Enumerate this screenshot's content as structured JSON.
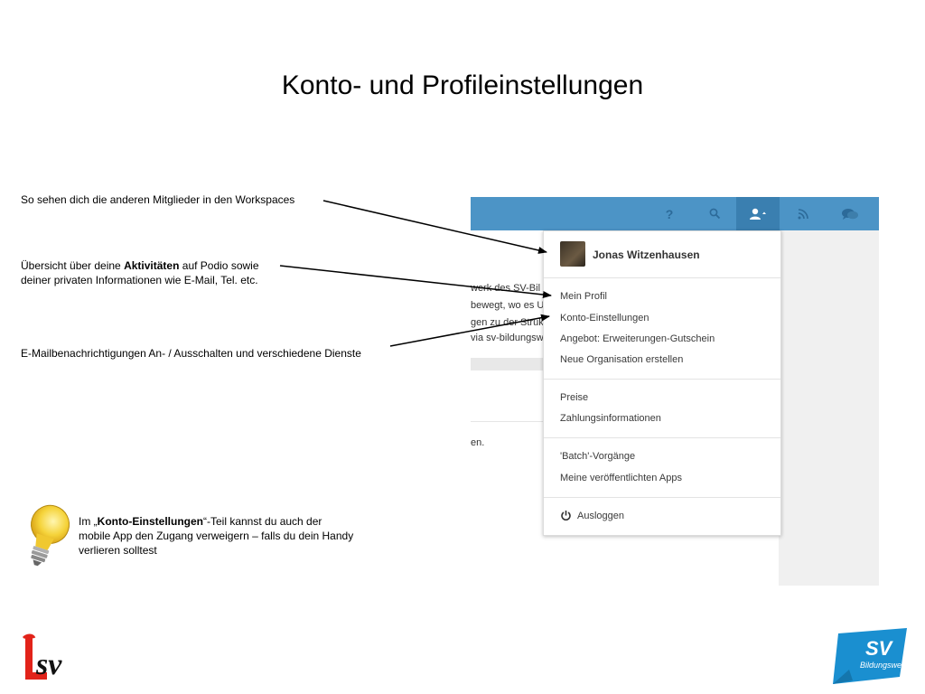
{
  "slide": {
    "title": "Konto- und Profileinstellungen"
  },
  "annotations": {
    "workspaces": "So sehen dich die anderen Mitglieder in den Workspaces",
    "activities_pre": "Übersicht über deine ",
    "activities_bold": "Aktivitäten",
    "activities_post": " auf Podio sowie",
    "activities_line2": "deiner privaten Informationen wie E-Mail, Tel. etc.",
    "email": "E-Mailbenachrichtigungen An- / Ausschalten und verschiedene Dienste"
  },
  "tip": {
    "pre": "Im „",
    "bold": "Konto-Einstellungen",
    "post": "“-Teil kannst du auch der",
    "line2": "mobile App den Zugang verweigern – falls du dein Handy",
    "line3": "verlieren solltest"
  },
  "topbar": {
    "icons": [
      "help-icon",
      "search-icon",
      "user-icon",
      "feed-icon",
      "chat-icon"
    ],
    "color": "#4c94c6"
  },
  "background_text": {
    "line1": "werk des SV-Bil",
    "line2": "bewegt, wo es U",
    "line3": "gen zu der Struk",
    "line4": "via sv-bildungsw",
    "line5": "en."
  },
  "menu": {
    "user_name": "Jonas Witzenhausen",
    "items_1": [
      "Mein Profil",
      "Konto-Einstellungen",
      "Angebot: Erweiterungen-Gutschein",
      "Neue Organisation erstellen"
    ],
    "items_2": [
      "Preise",
      "Zahlungsinformationen"
    ],
    "items_3": [
      "'Batch'-Vorgänge",
      "Meine veröffentlichten Apps"
    ],
    "logout": "Ausloggen"
  },
  "logos": {
    "left_icon": "lsv-logo",
    "right_icon": "sv-bildungswerk-logo",
    "right_text_1": "SV",
    "right_text_2": "Bildungswerk",
    "accent": "#1a8fd0"
  }
}
